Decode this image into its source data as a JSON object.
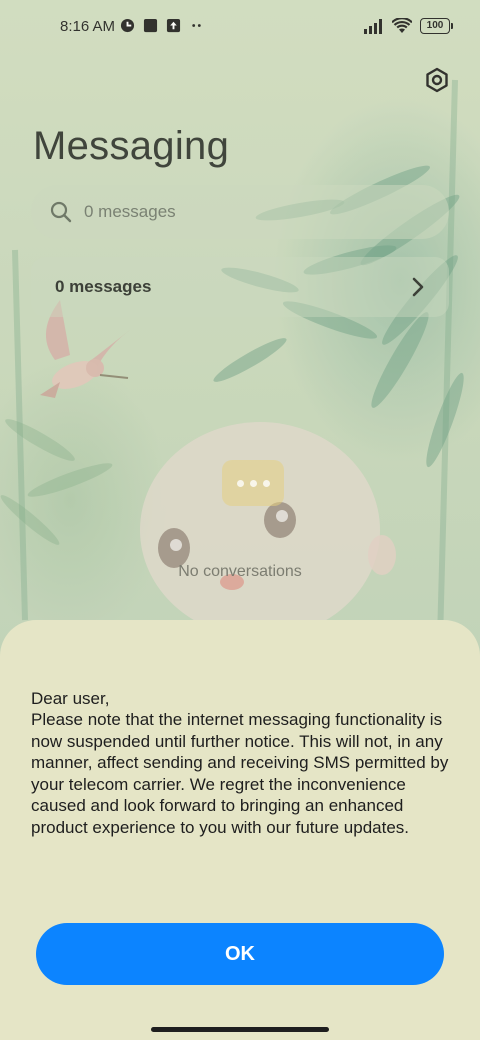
{
  "status_bar": {
    "time": "8:16 AM",
    "battery": "100",
    "icons": [
      "app-notification-icon",
      "square-notification-icon",
      "upload-notification-icon",
      "more-dots-icon",
      "signal-icon",
      "wifi-icon",
      "battery-icon"
    ]
  },
  "header": {
    "title": "Messaging",
    "settings_icon": "gear-icon"
  },
  "search": {
    "placeholder": "0 messages"
  },
  "summary": {
    "label": "0 messages",
    "chevron_icon": "chevron-right-icon"
  },
  "empty_state": {
    "text": "No conversations",
    "icon": "chat-bubble-icon"
  },
  "dialog": {
    "greeting": "Dear user,",
    "body": "Please note that the internet messaging functionality is now suspended until further notice. This will not, in any manner, affect sending and receiving SMS permitted by your telecom carrier. We regret the inconvenience caused and look forward to bringing an enhanced product experience to you with our future updates.",
    "ok_label": "OK"
  },
  "colors": {
    "accent": "#0c84ff",
    "sheet_background": "#e5e5c6",
    "text": "#1e1e1e"
  }
}
